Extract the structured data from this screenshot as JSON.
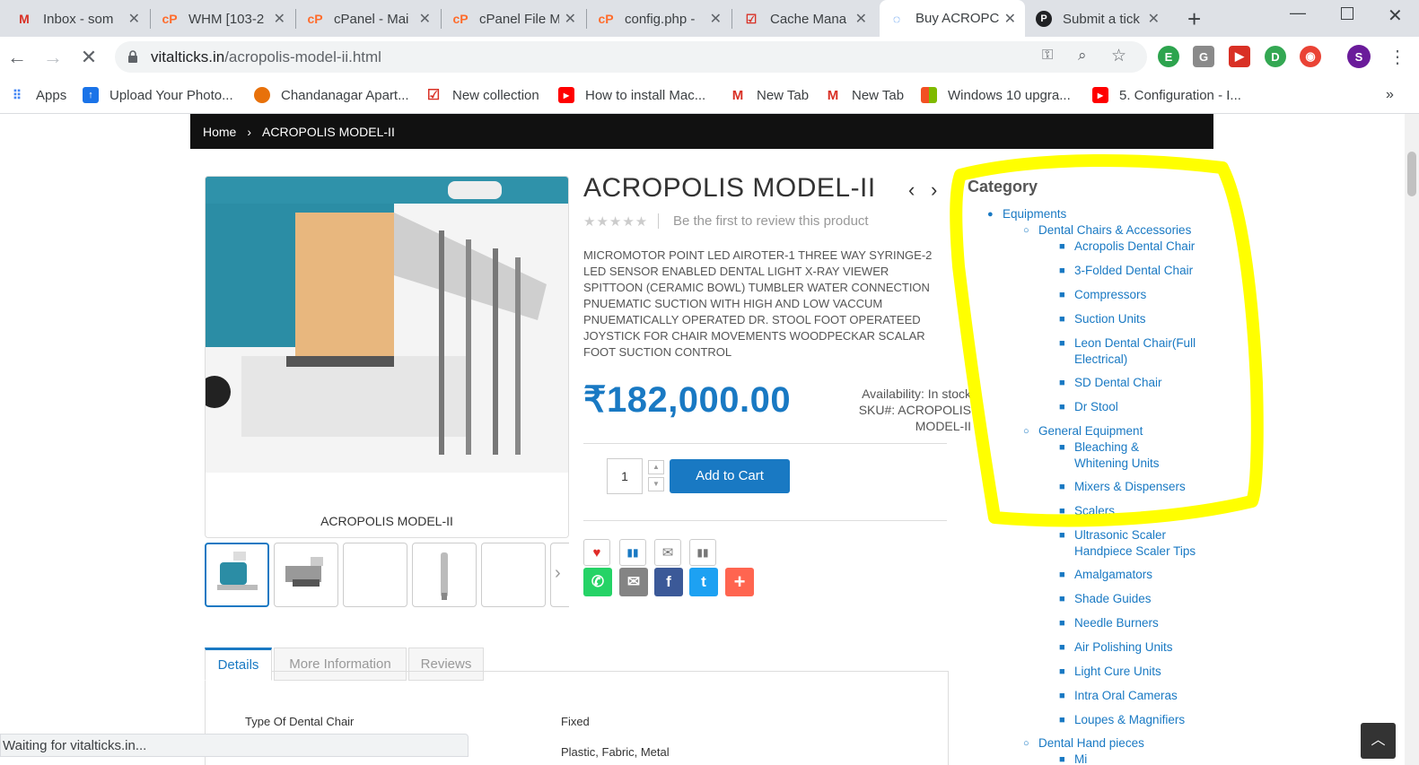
{
  "browser": {
    "tabs": [
      {
        "title": "Inbox - som",
        "icon": "gmail-icon",
        "color": "#d93025",
        "glyph": "M"
      },
      {
        "title": "WHM [103-2",
        "icon": "cpanel-icon",
        "color": "#ff6c2c",
        "glyph": "cP"
      },
      {
        "title": "cPanel - Mai",
        "icon": "cpanel-icon",
        "color": "#ff6c2c",
        "glyph": "cP"
      },
      {
        "title": "cPanel File M",
        "icon": "cpanel-icon",
        "color": "#ff6c2c",
        "glyph": "cP"
      },
      {
        "title": "config.php -",
        "icon": "cpanel-icon",
        "color": "#ff6c2c",
        "glyph": "cP"
      },
      {
        "title": "Cache Mana",
        "icon": "checkbox-icon",
        "color": "#d93025",
        "glyph": "☑"
      },
      {
        "title": "Buy ACROPC",
        "icon": "loading-icon",
        "color": "#1a73e8",
        "glyph": "◌"
      },
      {
        "title": "Submit a tick",
        "icon": "p-icon",
        "color": "#202124",
        "glyph": "P"
      }
    ],
    "new_tab": "+",
    "url_domain": "vitalticks.in",
    "url_path": "/acropolis-model-ii.html",
    "profile_initial": "S",
    "bookmarks": [
      {
        "label": "Apps",
        "icon": "apps-grid-icon",
        "color": "#4285f4"
      },
      {
        "label": "Upload Your Photo...",
        "icon": "upload-icon",
        "color": "#1a73e8"
      },
      {
        "label": "Chandanagar Apart...",
        "icon": "swirl-icon",
        "color": "#e8710a"
      },
      {
        "label": "New collection",
        "icon": "checkbox-icon",
        "color": "#d93025"
      },
      {
        "label": "How to install Mac...",
        "icon": "youtube-icon",
        "color": "#ff0000"
      },
      {
        "label": "New Tab",
        "icon": "gmail-icon",
        "color": "#d93025"
      },
      {
        "label": "New Tab",
        "icon": "gmail-icon",
        "color": "#d93025"
      },
      {
        "label": "Windows 10 upgra...",
        "icon": "windows-icon",
        "color": "#00a4ef"
      },
      {
        "label": "5. Configuration - I...",
        "icon": "youtube-icon",
        "color": "#ff0000"
      }
    ],
    "more": "»",
    "status_text": "Waiting for vitalticks.in..."
  },
  "breadcrumb": {
    "home": "Home",
    "current": "ACROPOLIS MODEL-II"
  },
  "product": {
    "title": "ACROPOLIS MODEL-II",
    "image_caption": "ACROPOLIS MODEL-II",
    "rating_stars": "★★★★★",
    "review_link": "Be the first to review this product",
    "description": "MICROMOTOR POINT LED AIROTER-1 THREE WAY SYRINGE-2 LED SENSOR ENABLED DENTAL LIGHT X-RAY VIEWER SPITTOON (CERAMIC BOWL) TUMBLER WATER CONNECTION PNUEMATIC SUCTION WITH HIGH AND LOW VACCUM PNUEMATICALLY OPERATED Dr. STOOL FOOT OPERATEED JOYSTICK FOR CHAIR MOVEMENTS WOODPECKAR SCALAR FOOT SUCTION CONTROL",
    "price": "₹182,000.00",
    "availability": "Availability: In stock",
    "sku": "SKU#:  ACROPOLIS MODEL-II",
    "qty": "1",
    "add_to_cart": "Add to Cart"
  },
  "tabs": {
    "details": "Details",
    "more_info": "More Information",
    "reviews": "Reviews"
  },
  "specs": {
    "row1_label": "Type Of Dental Chair",
    "row1_value": "Fixed",
    "row2_value": "Plastic, Fabric, Metal"
  },
  "category": {
    "heading": "Category",
    "equipments": "Equipments",
    "dental_chairs": "Dental Chairs & Accessories",
    "chairs": [
      "Acropolis Dental Chair",
      "3-Folded Dental Chair",
      "Compressors",
      "Suction Units",
      "Leon Dental Chair(Full",
      "Electrical)",
      "SD Dental Chair",
      "Dr Stool"
    ],
    "general": "General Equipment",
    "general_items": [
      "Bleaching &",
      "Whitening Units",
      "Mixers & Dispensers",
      "Scalers",
      "Ultrasonic Scaler",
      "Handpiece Scaler Tips",
      "Amalgamators",
      "Shade Guides",
      "Needle Burners",
      "Air Polishing Units",
      "Light Cure Units",
      "Intra Oral Cameras",
      "Loupes & Magnifiers"
    ],
    "handpieces": "Dental Hand pieces",
    "handpieces_sub": "Mi"
  },
  "colors": {
    "accent": "#1979c3",
    "highlight": "#ffff00"
  }
}
